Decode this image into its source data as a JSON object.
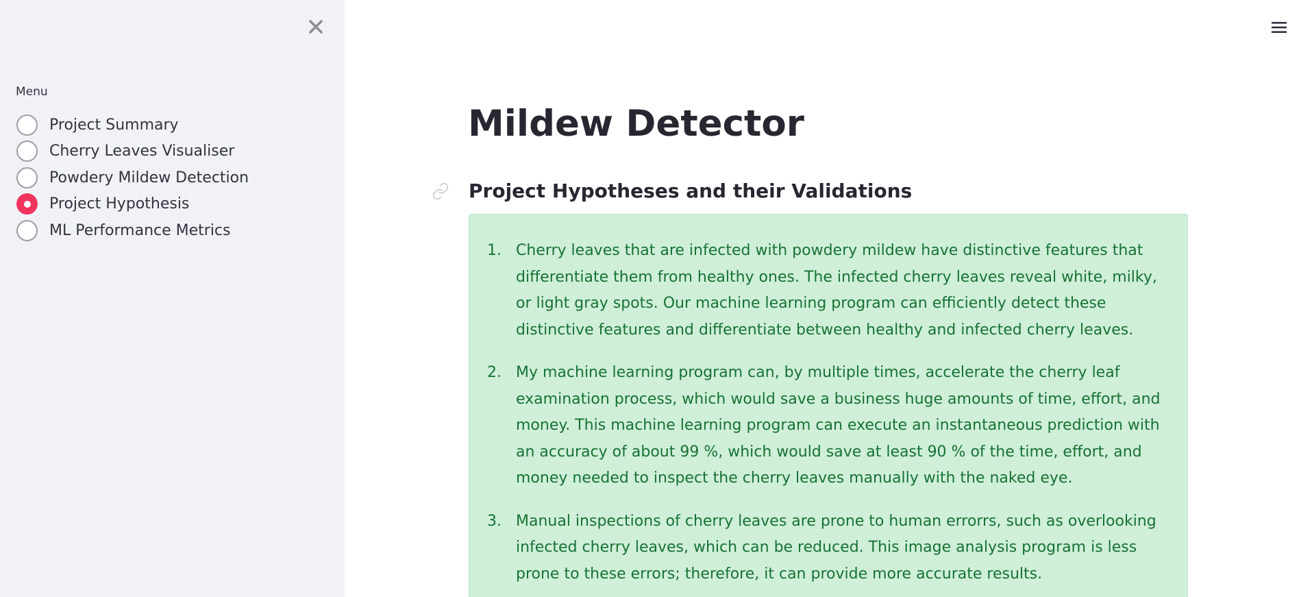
{
  "sidebar": {
    "close_icon": "close-icon",
    "menu_label": "Menu",
    "items": [
      {
        "label": "Project Summary",
        "selected": false
      },
      {
        "label": "Cherry Leaves Visualiser",
        "selected": false
      },
      {
        "label": "Powdery Mildew Detection",
        "selected": false
      },
      {
        "label": "Project Hypothesis",
        "selected": true
      },
      {
        "label": "ML Performance Metrics",
        "selected": false
      }
    ],
    "accent_color": "#f0355f"
  },
  "header": {
    "menu_icon": "hamburger-menu-icon"
  },
  "main": {
    "title": "Mildew Detector",
    "section_title": "Project Hypotheses and their Validations",
    "hypotheses": [
      {
        "number": "1.",
        "text": "Cherry leaves that are infected with powdery mildew have distinctive features that differentiate them from healthy ones. The infected cherry leaves reveal white, milky, or light gray spots. Our machine learning program can efficiently detect these distinctive features and differentiate between healthy and infected cherry leaves."
      },
      {
        "number": "2.",
        "text": "My machine learning program can, by multiple times, accelerate the cherry leaf examination process, which would save a business huge amounts of time, effort, and money. This machine learning program can execute an instantaneous prediction with an accuracy of about 99 %, which would save at least 90 % of the time, effort, and money needed to inspect the cherry leaves manually with the naked eye."
      },
      {
        "number": "3.",
        "text": "Manual inspections of cherry leaves are prone to human errorrs, such as overlooking infected cherry leaves, which can be reduced. This image analysis program is less prone to these errors; therefore, it can provide more accurate results."
      }
    ],
    "success_bg_color": "#cfefd9",
    "success_text_color": "#177233"
  }
}
